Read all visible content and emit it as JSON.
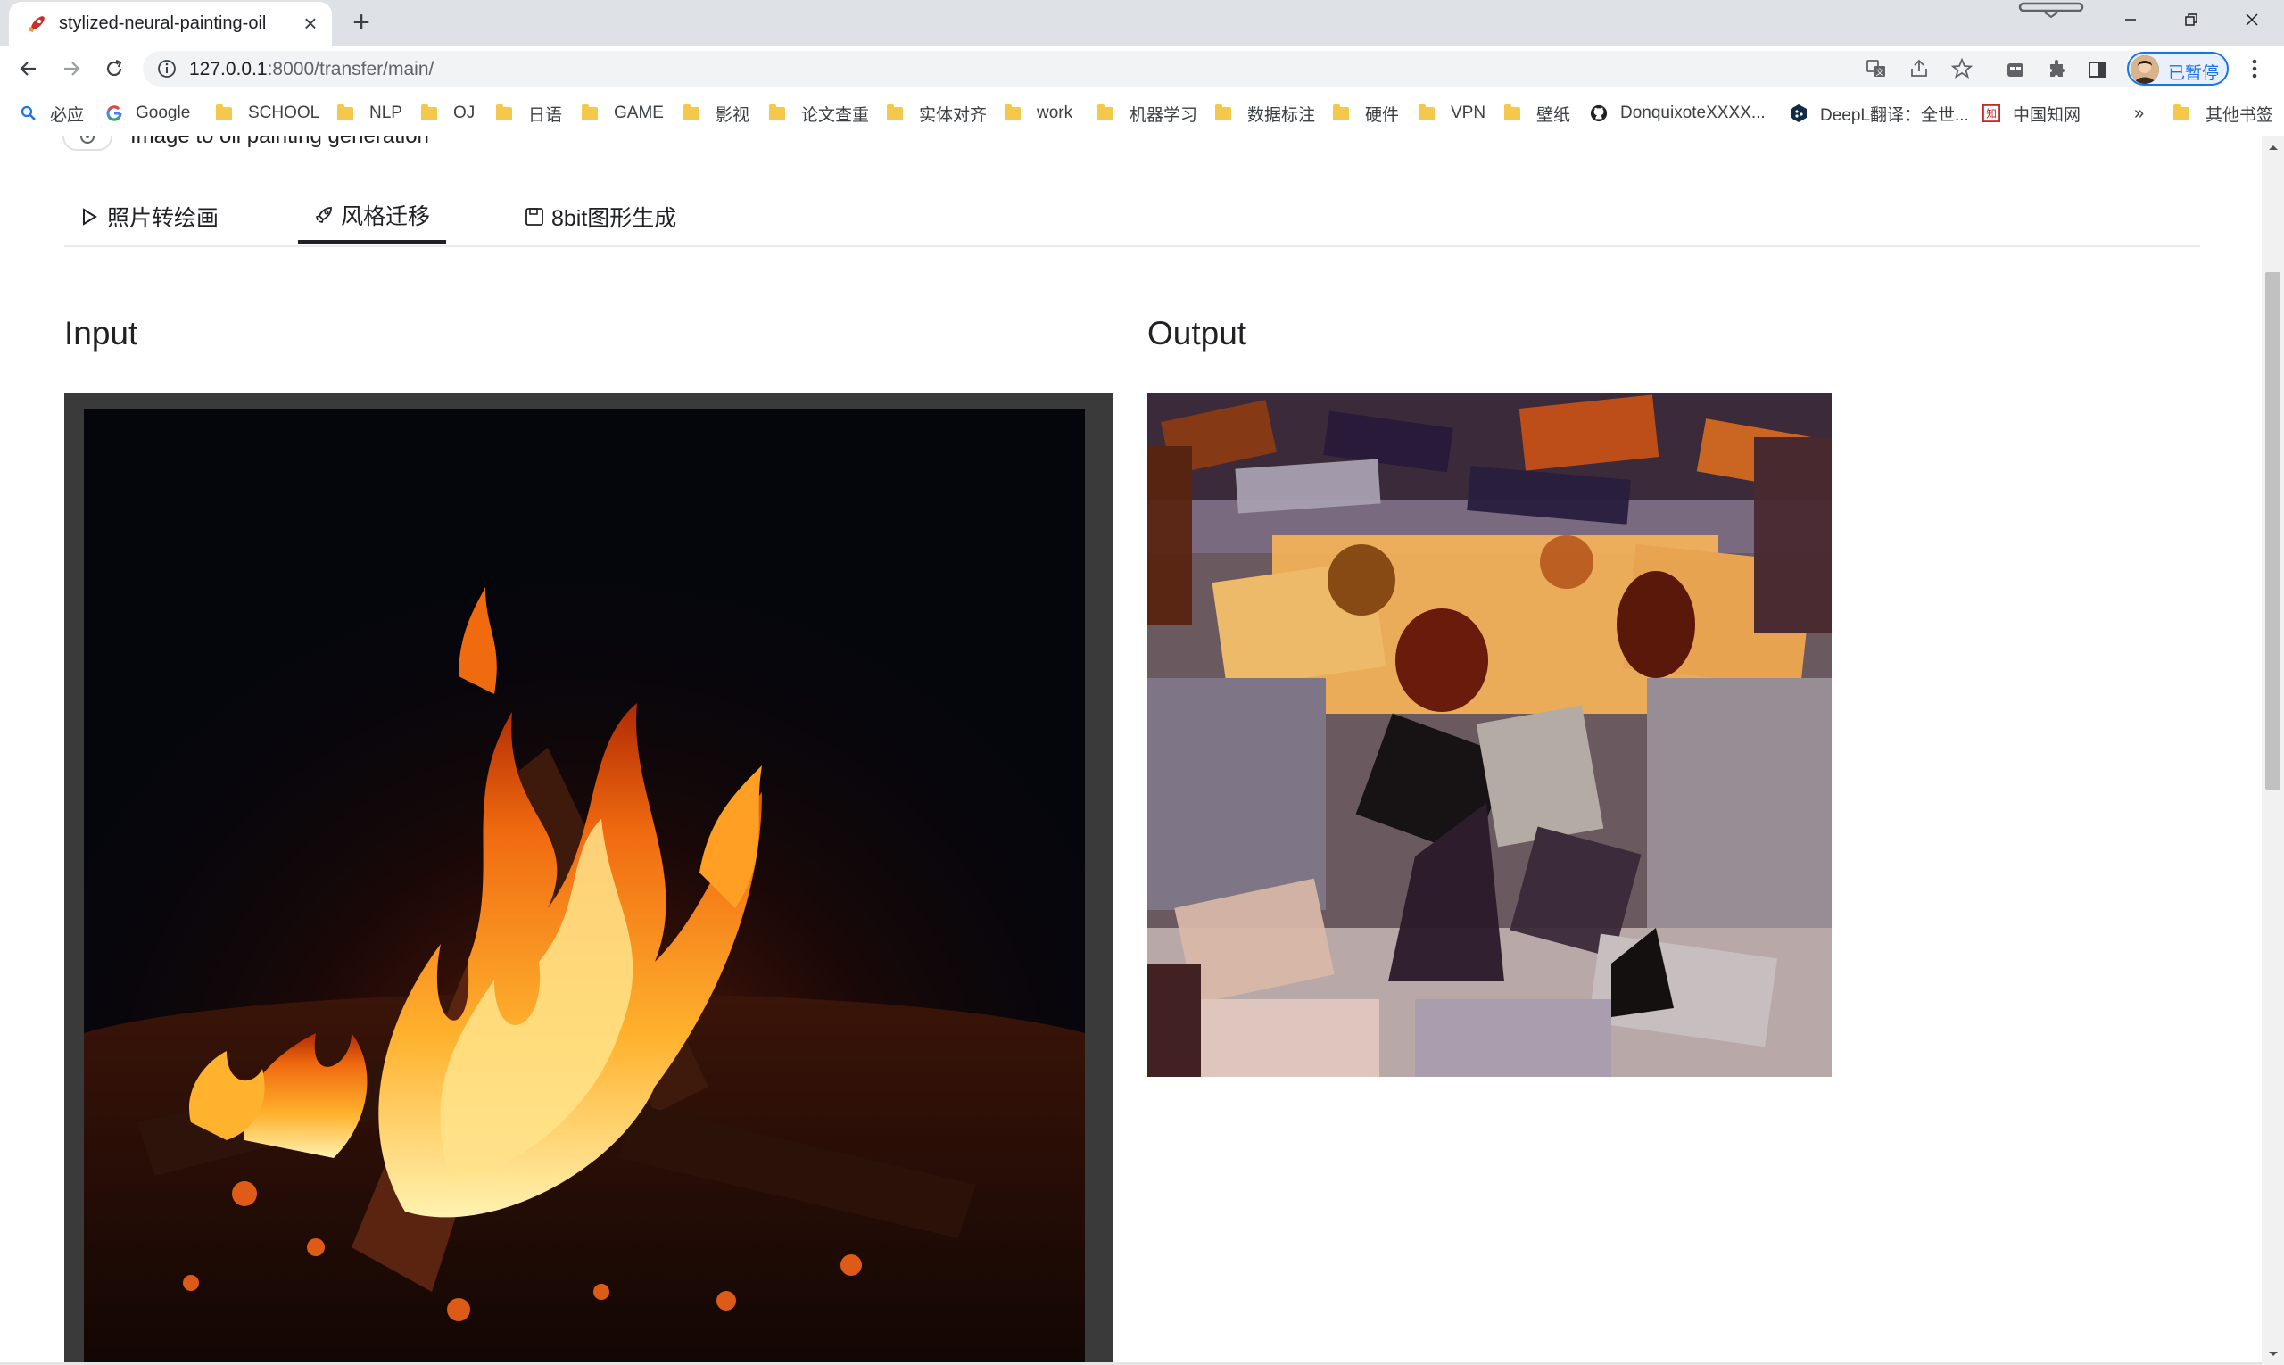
{
  "browser": {
    "tab_title": "stylized-neural-painting-oil",
    "url_host": "127.0.0.1",
    "url_path": ":8000/transfer/main/",
    "profile_label": "已暂停"
  },
  "bookmarks": [
    {
      "label": "必应",
      "icon": "bing-search-icon"
    },
    {
      "label": "Google",
      "icon": "google-icon"
    },
    {
      "label": "SCHOOL",
      "icon": "folder-icon"
    },
    {
      "label": "NLP",
      "icon": "folder-icon"
    },
    {
      "label": "OJ",
      "icon": "folder-icon"
    },
    {
      "label": "日语",
      "icon": "folder-icon"
    },
    {
      "label": "GAME",
      "icon": "folder-icon"
    },
    {
      "label": "影视",
      "icon": "folder-icon"
    },
    {
      "label": "论文查重",
      "icon": "folder-icon"
    },
    {
      "label": "实体对齐",
      "icon": "folder-icon"
    },
    {
      "label": "work",
      "icon": "folder-icon"
    },
    {
      "label": "机器学习",
      "icon": "folder-icon"
    },
    {
      "label": "数据标注",
      "icon": "folder-icon"
    },
    {
      "label": "硬件",
      "icon": "folder-icon"
    },
    {
      "label": "VPN",
      "icon": "folder-icon"
    },
    {
      "label": "壁纸",
      "icon": "folder-icon"
    },
    {
      "label": "DonquixoteXXXX...",
      "icon": "github-icon"
    },
    {
      "label": "DeepL翻译：全世...",
      "icon": "deepl-icon"
    },
    {
      "label": "中国知网",
      "icon": "cnki-icon"
    }
  ],
  "bookmarks_overflow": "»",
  "other_bookmarks": "其他书签",
  "page": {
    "header_text": "Image to oil painting generation",
    "tabs": [
      {
        "label": "照片转绘画",
        "icon": "play-icon"
      },
      {
        "label": "风格迁移",
        "icon": "rocket-icon"
      },
      {
        "label": "8bit图形生成",
        "icon": "save-icon"
      }
    ],
    "active_tab_index": 1,
    "input_title": "Input",
    "output_title": "Output"
  }
}
